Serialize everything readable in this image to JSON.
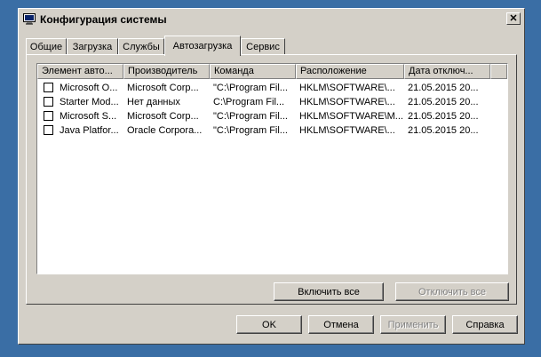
{
  "window": {
    "title": "Конфигурация системы",
    "close_glyph": "✕",
    "icon": "msconfig-icon"
  },
  "tabs": [
    {
      "label": "Общие"
    },
    {
      "label": "Загрузка"
    },
    {
      "label": "Службы"
    },
    {
      "label": "Автозагрузка",
      "active": true
    },
    {
      "label": "Сервис"
    }
  ],
  "startup_list": {
    "columns": [
      "Элемент авто...",
      "Производитель",
      "Команда",
      "Расположение",
      "Дата отключ..."
    ],
    "rows": [
      {
        "checked": false,
        "item": "Microsoft O...",
        "vendor": "Microsoft Corp...",
        "command": "\"C:\\Program Fil...",
        "location": "HKLM\\SOFTWARE\\...",
        "date": "21.05.2015 20..."
      },
      {
        "checked": false,
        "item": "Starter Mod...",
        "vendor": "Нет данных",
        "command": "C:\\Program Fil...",
        "location": "HKLM\\SOFTWARE\\...",
        "date": "21.05.2015 20..."
      },
      {
        "checked": false,
        "item": "Microsoft S...",
        "vendor": "Microsoft Corp...",
        "command": "\"C:\\Program Fil...",
        "location": "HKLM\\SOFTWARE\\M...",
        "date": "21.05.2015 20..."
      },
      {
        "checked": false,
        "item": "Java Platfor...",
        "vendor": "Oracle Corpora...",
        "command": "\"C:\\Program Fil...",
        "location": "HKLM\\SOFTWARE\\...",
        "date": "21.05.2015 20..."
      }
    ]
  },
  "panel_buttons": {
    "enable_all": "Включить все",
    "disable_all": "Отключить все"
  },
  "dialog_buttons": {
    "ok": "OK",
    "cancel": "Отмена",
    "apply": "Применить",
    "help": "Справка"
  },
  "colors": {
    "desktop": "#3a6ea5",
    "face": "#d4d0c8"
  }
}
